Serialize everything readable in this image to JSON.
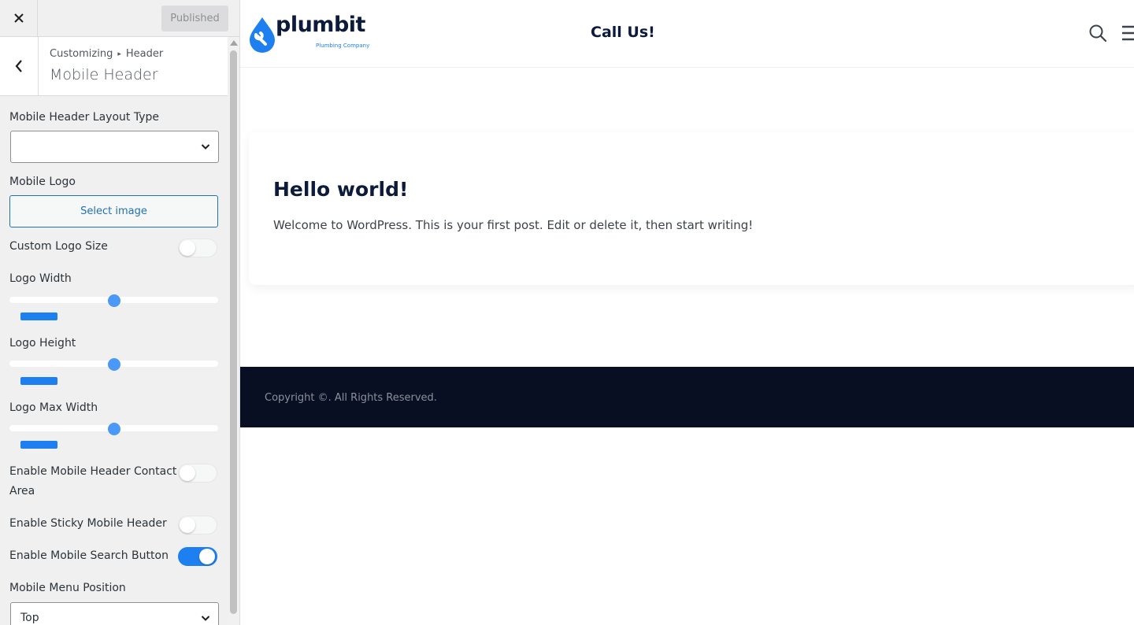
{
  "topbar": {
    "close_icon": "close-icon",
    "publish_label": "Published"
  },
  "section": {
    "breadcrumb_root": "Customizing",
    "breadcrumb_sep": "▸",
    "breadcrumb_parent": "Header",
    "title": "Mobile Header"
  },
  "controls": {
    "layout_type": {
      "label": "Mobile Header Layout Type",
      "value": ""
    },
    "mobile_logo": {
      "label": "Mobile Logo",
      "button": "Select image"
    },
    "custom_logo_size": {
      "label": "Custom Logo Size",
      "enabled": false
    },
    "logo_width": {
      "label": "Logo Width",
      "level": 0.5
    },
    "logo_height": {
      "label": "Logo Height",
      "level": 0.5
    },
    "logo_max_width": {
      "label": "Logo Max Width",
      "level": 0.5
    },
    "contact_area": {
      "label_line1": "Enable Mobile Header Contact",
      "label_line2": "Area",
      "enabled": false
    },
    "sticky_header": {
      "label": "Enable Sticky Mobile Header",
      "enabled": false
    },
    "search_button": {
      "label": "Enable Mobile Search Button",
      "enabled": true
    },
    "menu_position": {
      "label": "Mobile Menu Position",
      "value": "Top"
    }
  },
  "preview": {
    "logo_text": "plumbit",
    "logo_tagline": "Plumbing Company",
    "header_cta": "Call Us!",
    "post_title": "Hello world!",
    "post_excerpt": "Welcome to WordPress. This is your first post. Edit or delete it, then start writing!",
    "footer_text": "Copyright ©. All Rights Reserved."
  },
  "colors": {
    "accent": "#1d7ff0",
    "slider_thumb": "#4a98f7",
    "navy": "#0c1a3b",
    "footer_bg": "#080f22",
    "logo_blue": "#1d7ff0"
  }
}
